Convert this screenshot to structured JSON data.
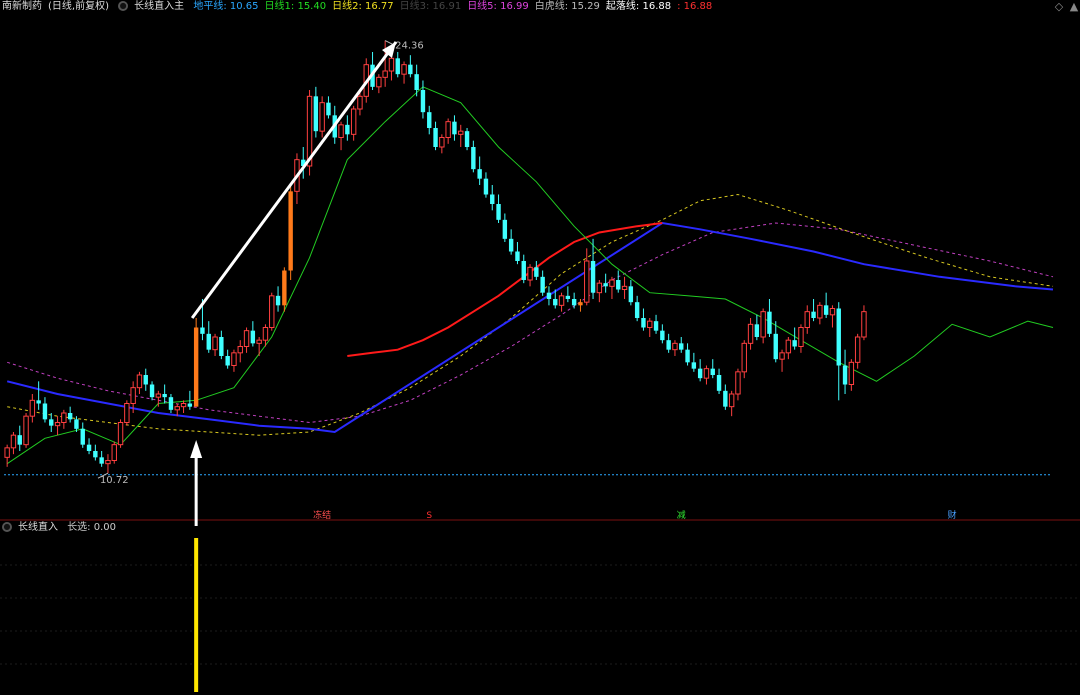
{
  "window": {
    "stock_name": "南新制药",
    "period_label": "(日线,前复权)"
  },
  "main_indicator": {
    "name": "长线直入主",
    "items": [
      {
        "label": "地平线:",
        "value": "10.65",
        "color": "#2aa7ff"
      },
      {
        "label": "日线1:",
        "value": "15.40",
        "color": "#22dd22"
      },
      {
        "label": "日线2:",
        "value": "16.77",
        "color": "#f0e020"
      },
      {
        "label": "日线3:",
        "value": "16.91",
        "color": "#444444"
      },
      {
        "label": "日线5:",
        "value": "16.99",
        "color": "#dd44dd"
      },
      {
        "label": "白虎线:",
        "value": "15.29",
        "color": "#bbbbbb"
      },
      {
        "label": "起落线:",
        "value": "16.88",
        "color": "#ffffff"
      },
      {
        "label": ":",
        "value": "16.88",
        "color": "#ff3030"
      }
    ]
  },
  "sub_indicator": {
    "name": "长线直入",
    "items": [
      {
        "label": "长选:",
        "value": "0.00",
        "color": "#cccccc"
      }
    ]
  },
  "annotations": {
    "high_label": "24.36",
    "low_label": "10.72",
    "events": [
      "冻结",
      "S",
      "减",
      "财"
    ]
  },
  "icons": {
    "collapse": "◇",
    "scroll": "▲"
  },
  "colors": {
    "up": "#ff4040",
    "down": "#40ffff",
    "highlight": "#ff7a1a",
    "baseline": "#2aa7ff",
    "ma_red": "#ff1a1a",
    "ma_blue": "#2a2aff",
    "signal_bar": "#ffe600"
  },
  "chart_data": {
    "type": "candlestick",
    "price_range": [
      9.6,
      25.2
    ],
    "baseline_value": 10.65,
    "high_value": 24.36,
    "low_value": 10.72,
    "candles": [
      [
        11.2,
        11.6,
        10.9,
        11.5
      ],
      [
        11.5,
        12.0,
        11.3,
        11.9
      ],
      [
        11.9,
        12.2,
        11.4,
        11.6
      ],
      [
        11.6,
        12.6,
        11.5,
        12.5
      ],
      [
        12.5,
        13.2,
        12.3,
        13.0
      ],
      [
        13.0,
        13.6,
        12.7,
        12.9
      ],
      [
        12.9,
        13.1,
        12.3,
        12.4
      ],
      [
        12.4,
        12.6,
        12.0,
        12.2
      ],
      [
        12.2,
        12.5,
        11.9,
        12.3
      ],
      [
        12.3,
        12.7,
        12.1,
        12.6
      ],
      [
        12.6,
        12.8,
        12.3,
        12.4
      ],
      [
        12.4,
        12.5,
        12.0,
        12.1
      ],
      [
        12.1,
        12.3,
        11.5,
        11.6
      ],
      [
        11.6,
        11.8,
        11.3,
        11.4
      ],
      [
        11.4,
        11.6,
        11.1,
        11.2
      ],
      [
        11.2,
        11.4,
        10.9,
        11.0
      ],
      [
        11.0,
        11.3,
        10.7,
        11.1
      ],
      [
        11.1,
        11.7,
        11.0,
        11.6
      ],
      [
        11.6,
        12.4,
        11.5,
        12.3
      ],
      [
        12.3,
        13.0,
        12.2,
        12.9
      ],
      [
        12.9,
        13.6,
        12.6,
        13.4
      ],
      [
        13.4,
        13.9,
        13.2,
        13.8
      ],
      [
        13.8,
        14.0,
        13.3,
        13.5
      ],
      [
        13.5,
        13.6,
        13.0,
        13.1
      ],
      [
        13.1,
        13.3,
        12.8,
        13.2
      ],
      [
        13.2,
        13.5,
        12.9,
        13.1
      ],
      [
        13.1,
        13.2,
        12.6,
        12.7
      ],
      [
        12.7,
        12.9,
        12.5,
        12.8
      ],
      [
        12.8,
        13.0,
        12.6,
        12.9
      ],
      [
        12.9,
        13.3,
        12.7,
        12.8
      ],
      [
        12.8,
        15.6,
        12.8,
        15.3
      ],
      [
        15.3,
        16.2,
        14.9,
        15.1
      ],
      [
        15.1,
        15.5,
        14.5,
        14.6
      ],
      [
        14.6,
        15.1,
        14.4,
        15.0
      ],
      [
        15.0,
        15.2,
        14.3,
        14.4
      ],
      [
        14.4,
        14.6,
        14.0,
        14.1
      ],
      [
        14.1,
        14.6,
        13.9,
        14.5
      ],
      [
        14.5,
        14.9,
        14.2,
        14.7
      ],
      [
        14.7,
        15.3,
        14.5,
        15.2
      ],
      [
        15.2,
        15.5,
        14.7,
        14.8
      ],
      [
        14.8,
        15.0,
        14.4,
        14.9
      ],
      [
        14.9,
        15.4,
        14.7,
        15.3
      ],
      [
        15.3,
        16.4,
        15.2,
        16.3
      ],
      [
        16.3,
        16.6,
        15.8,
        16.0
      ],
      [
        16.0,
        17.2,
        15.8,
        17.1
      ],
      [
        17.1,
        19.8,
        16.8,
        19.6
      ],
      [
        19.6,
        20.8,
        19.2,
        20.6
      ],
      [
        20.6,
        21.0,
        20.0,
        20.4
      ],
      [
        20.4,
        22.8,
        20.1,
        22.6
      ],
      [
        22.6,
        22.9,
        21.3,
        21.5
      ],
      [
        21.5,
        22.6,
        21.3,
        22.4
      ],
      [
        22.4,
        22.6,
        21.9,
        22.0
      ],
      [
        22.0,
        22.3,
        21.1,
        21.3
      ],
      [
        21.3,
        21.8,
        20.9,
        21.7
      ],
      [
        21.7,
        22.0,
        21.2,
        21.4
      ],
      [
        21.4,
        22.3,
        21.2,
        22.2
      ],
      [
        22.2,
        22.8,
        22.0,
        22.6
      ],
      [
        22.6,
        23.8,
        22.4,
        23.6
      ],
      [
        23.6,
        24.0,
        22.8,
        22.9
      ],
      [
        22.9,
        23.3,
        22.7,
        23.2
      ],
      [
        23.2,
        24.36,
        22.9,
        23.4
      ],
      [
        23.4,
        23.9,
        23.1,
        23.8
      ],
      [
        23.8,
        24.0,
        23.2,
        23.3
      ],
      [
        23.3,
        23.7,
        23.0,
        23.6
      ],
      [
        23.6,
        23.9,
        23.2,
        23.3
      ],
      [
        23.3,
        23.6,
        22.6,
        22.8
      ],
      [
        22.8,
        23.1,
        21.9,
        22.1
      ],
      [
        22.1,
        22.3,
        21.4,
        21.6
      ],
      [
        21.6,
        21.8,
        20.9,
        21.0
      ],
      [
        21.0,
        21.4,
        20.8,
        21.3
      ],
      [
        21.3,
        21.9,
        21.1,
        21.8
      ],
      [
        21.8,
        22.0,
        21.2,
        21.4
      ],
      [
        21.4,
        21.7,
        21.0,
        21.5
      ],
      [
        21.5,
        21.6,
        20.9,
        21.0
      ],
      [
        21.0,
        21.2,
        20.2,
        20.3
      ],
      [
        20.3,
        20.7,
        19.8,
        20.0
      ],
      [
        20.0,
        20.2,
        19.4,
        19.5
      ],
      [
        19.5,
        19.8,
        19.0,
        19.2
      ],
      [
        19.2,
        19.5,
        18.6,
        18.7
      ],
      [
        18.7,
        18.9,
        18.0,
        18.1
      ],
      [
        18.1,
        18.4,
        17.6,
        17.7
      ],
      [
        17.7,
        18.0,
        17.3,
        17.4
      ],
      [
        17.4,
        17.6,
        16.7,
        16.8
      ],
      [
        16.8,
        17.3,
        16.6,
        17.2
      ],
      [
        17.2,
        17.4,
        16.8,
        16.9
      ],
      [
        16.9,
        17.1,
        16.3,
        16.4
      ],
      [
        16.4,
        16.6,
        16.0,
        16.2
      ],
      [
        16.2,
        16.5,
        15.9,
        16.0
      ],
      [
        16.0,
        16.4,
        15.8,
        16.3
      ],
      [
        16.3,
        16.6,
        16.1,
        16.2
      ],
      [
        16.2,
        16.4,
        15.9,
        16.0
      ],
      [
        16.0,
        16.2,
        15.8,
        16.1
      ],
      [
        16.1,
        17.8,
        16.0,
        17.4
      ],
      [
        17.4,
        18.1,
        16.2,
        16.4
      ],
      [
        16.4,
        16.8,
        16.1,
        16.7
      ],
      [
        16.7,
        17.0,
        16.4,
        16.6
      ],
      [
        16.6,
        16.9,
        16.2,
        16.8
      ],
      [
        16.8,
        17.1,
        16.4,
        16.5
      ],
      [
        16.5,
        16.9,
        16.2,
        16.6
      ],
      [
        16.6,
        16.8,
        16.0,
        16.1
      ],
      [
        16.1,
        16.3,
        15.5,
        15.6
      ],
      [
        15.6,
        15.9,
        15.2,
        15.3
      ],
      [
        15.3,
        15.6,
        15.0,
        15.5
      ],
      [
        15.5,
        15.7,
        15.1,
        15.2
      ],
      [
        15.2,
        15.4,
        14.8,
        14.9
      ],
      [
        14.9,
        15.1,
        14.5,
        14.6
      ],
      [
        14.6,
        14.9,
        14.4,
        14.8
      ],
      [
        14.8,
        15.0,
        14.5,
        14.6
      ],
      [
        14.6,
        14.8,
        14.1,
        14.2
      ],
      [
        14.2,
        14.5,
        13.9,
        14.0
      ],
      [
        14.0,
        14.3,
        13.6,
        13.7
      ],
      [
        13.7,
        14.1,
        13.5,
        14.0
      ],
      [
        14.0,
        14.3,
        13.7,
        13.8
      ],
      [
        13.8,
        14.0,
        13.2,
        13.3
      ],
      [
        13.3,
        13.5,
        12.7,
        12.8
      ],
      [
        12.8,
        13.3,
        12.5,
        13.2
      ],
      [
        13.2,
        14.0,
        13.0,
        13.9
      ],
      [
        13.9,
        14.9,
        13.7,
        14.8
      ],
      [
        14.8,
        15.6,
        14.6,
        15.4
      ],
      [
        15.4,
        15.7,
        14.9,
        15.0
      ],
      [
        15.0,
        15.9,
        14.8,
        15.8
      ],
      [
        15.8,
        16.2,
        15.0,
        15.1
      ],
      [
        15.1,
        15.5,
        14.2,
        14.3
      ],
      [
        14.3,
        14.6,
        13.9,
        14.5
      ],
      [
        14.5,
        15.0,
        14.3,
        14.9
      ],
      [
        14.9,
        15.3,
        14.6,
        14.7
      ],
      [
        14.7,
        15.4,
        14.5,
        15.3
      ],
      [
        15.3,
        16.0,
        15.1,
        15.8
      ],
      [
        15.8,
        16.2,
        15.5,
        15.6
      ],
      [
        15.6,
        16.1,
        15.4,
        16.0
      ],
      [
        16.0,
        16.4,
        15.6,
        15.7
      ],
      [
        15.7,
        16.0,
        15.3,
        15.9
      ],
      [
        15.9,
        16.1,
        13.0,
        14.1
      ],
      [
        14.1,
        14.6,
        13.2,
        13.5
      ],
      [
        13.5,
        14.3,
        13.3,
        14.2
      ],
      [
        14.2,
        15.1,
        14.0,
        15.0
      ],
      [
        15.0,
        16.0,
        14.9,
        15.8
      ]
    ],
    "highlight_indices": [
      30,
      44,
      45,
      91
    ],
    "ma_red": [
      [
        0,
        null
      ],
      [
        52,
        null
      ],
      [
        54,
        14.4
      ],
      [
        58,
        14.5
      ],
      [
        62,
        14.6
      ],
      [
        66,
        14.9
      ],
      [
        70,
        15.3
      ],
      [
        74,
        15.8
      ],
      [
        78,
        16.3
      ],
      [
        82,
        16.9
      ],
      [
        86,
        17.5
      ],
      [
        90,
        18.0
      ],
      [
        94,
        18.3
      ],
      [
        100,
        18.5
      ],
      [
        104,
        18.6
      ]
    ],
    "ma_blue": [
      [
        0,
        13.6
      ],
      [
        8,
        13.2
      ],
      [
        16,
        12.9
      ],
      [
        24,
        12.6
      ],
      [
        32,
        12.4
      ],
      [
        40,
        12.2
      ],
      [
        48,
        12.1
      ],
      [
        52,
        12.0
      ],
      [
        104,
        18.6
      ],
      [
        110,
        18.4
      ],
      [
        118,
        18.1
      ],
      [
        128,
        17.7
      ],
      [
        136,
        17.3
      ],
      [
        148,
        16.9
      ],
      [
        160,
        16.6
      ],
      [
        166,
        16.5
      ]
    ],
    "ma_yellow_dash": [
      [
        0,
        12.8
      ],
      [
        8,
        12.5
      ],
      [
        16,
        12.3
      ],
      [
        24,
        12.1
      ],
      [
        32,
        12.0
      ],
      [
        40,
        11.9
      ],
      [
        48,
        12.0
      ],
      [
        56,
        12.6
      ],
      [
        64,
        13.4
      ],
      [
        72,
        14.4
      ],
      [
        80,
        15.6
      ],
      [
        88,
        17.0
      ],
      [
        96,
        18.0
      ],
      [
        104,
        18.7
      ],
      [
        110,
        19.3
      ],
      [
        116,
        19.5
      ],
      [
        124,
        19.0
      ],
      [
        134,
        18.3
      ],
      [
        146,
        17.5
      ],
      [
        156,
        16.9
      ],
      [
        166,
        16.6
      ]
    ],
    "ma_magenta_dash": [
      [
        0,
        14.2
      ],
      [
        8,
        13.7
      ],
      [
        16,
        13.3
      ],
      [
        24,
        13.0
      ],
      [
        32,
        12.7
      ],
      [
        40,
        12.5
      ],
      [
        48,
        12.3
      ],
      [
        56,
        12.5
      ],
      [
        64,
        13.0
      ],
      [
        72,
        13.8
      ],
      [
        80,
        14.7
      ],
      [
        88,
        15.7
      ],
      [
        96,
        16.8
      ],
      [
        104,
        17.6
      ],
      [
        112,
        18.3
      ],
      [
        122,
        18.6
      ],
      [
        132,
        18.4
      ],
      [
        144,
        17.9
      ],
      [
        156,
        17.4
      ],
      [
        166,
        16.9
      ]
    ],
    "ma_green": [
      [
        0,
        11.0
      ],
      [
        6,
        11.8
      ],
      [
        12,
        12.1
      ],
      [
        18,
        11.6
      ],
      [
        24,
        12.9
      ],
      [
        30,
        13.0
      ],
      [
        36,
        13.4
      ],
      [
        42,
        15.0
      ],
      [
        48,
        17.5
      ],
      [
        54,
        20.6
      ],
      [
        60,
        21.8
      ],
      [
        66,
        22.9
      ],
      [
        72,
        22.4
      ],
      [
        78,
        21.0
      ],
      [
        84,
        19.9
      ],
      [
        90,
        18.5
      ],
      [
        96,
        17.3
      ],
      [
        102,
        16.4
      ],
      [
        108,
        16.3
      ],
      [
        114,
        16.2
      ],
      [
        120,
        15.6
      ],
      [
        126,
        14.9
      ],
      [
        132,
        14.2
      ],
      [
        138,
        13.6
      ],
      [
        144,
        14.4
      ],
      [
        150,
        15.4
      ],
      [
        156,
        15.0
      ],
      [
        162,
        15.5
      ],
      [
        166,
        15.3
      ]
    ],
    "signal_index": 30
  }
}
